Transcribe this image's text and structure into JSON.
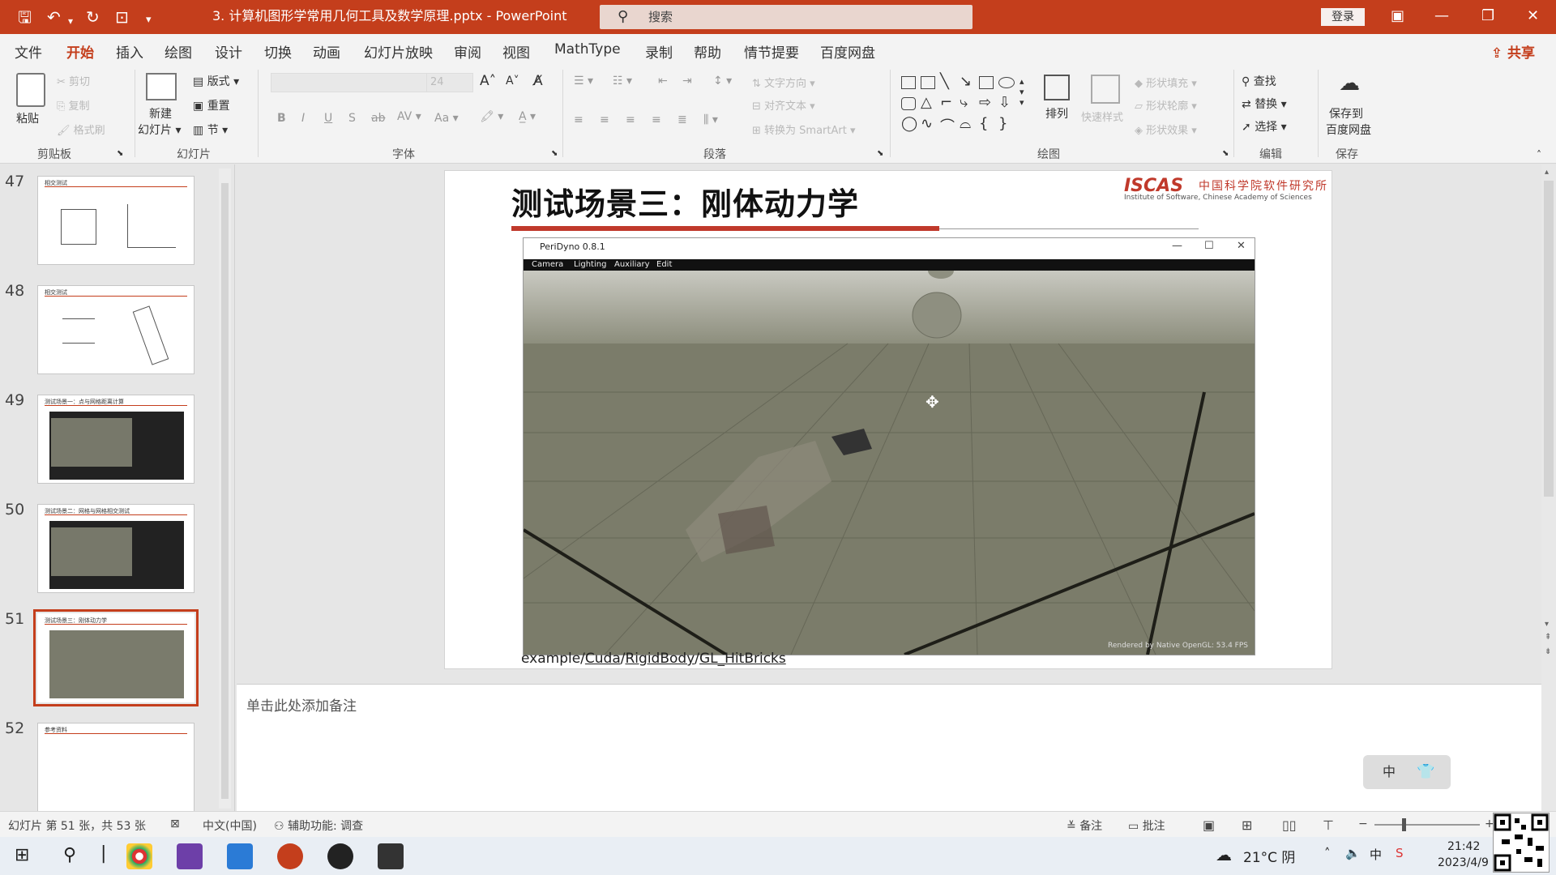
{
  "titlebar": {
    "doc_title": "3. 计算机图形学常用几何工具及数学原理.pptx - PowerPoint",
    "search_placeholder": "搜索",
    "signin_label": "登录"
  },
  "menu_tabs": [
    "文件",
    "开始",
    "插入",
    "绘图",
    "设计",
    "切换",
    "动画",
    "幻灯片放映",
    "审阅",
    "视图",
    "MathType",
    "录制",
    "帮助",
    "情节提要",
    "百度网盘"
  ],
  "share_label": "共享",
  "ribbon": {
    "clipboard": {
      "paste": "粘贴",
      "cut": "剪切",
      "copy": "复制",
      "format_painter": "格式刷",
      "group": "剪贴板"
    },
    "slides": {
      "new_slide": "新建",
      "new_slide2": "幻灯片",
      "layout": "版式",
      "reset": "重置",
      "section": "节",
      "group": "幻灯片"
    },
    "font": {
      "group": "字体",
      "size": "24"
    },
    "paragraph": {
      "text_direction": "文字方向",
      "align_text": "对齐文本",
      "smartart": "转换为 SmartArt",
      "group": "段落"
    },
    "drawing": {
      "arrange": "排列",
      "quick_styles": "快速样式",
      "shape_fill": "形状填充",
      "shape_outline": "形状轮廓",
      "shape_effects": "形状效果",
      "group": "绘图"
    },
    "editing": {
      "find": "查找",
      "replace": "替换",
      "select": "选择",
      "group": "编辑"
    },
    "save": {
      "save_to": "保存到",
      "baidu": "百度网盘",
      "group": "保存"
    }
  },
  "thumbnails": [
    {
      "num": "47",
      "title": "相交测试"
    },
    {
      "num": "48",
      "title": "相交测试"
    },
    {
      "num": "49",
      "title": "测试场景一：点与网格距离计算"
    },
    {
      "num": "50",
      "title": "测试场景二：网格与网格相交测试"
    },
    {
      "num": "51",
      "title": "测试场景三：刚体动力学"
    },
    {
      "num": "52",
      "title": "参考资料"
    }
  ],
  "slide": {
    "title": "测试场景三：刚体动力学",
    "logo_main": "ISCAS",
    "logo_cn": "中国科学院软件研究所",
    "logo_en": "Institute of Software, Chinese Academy of Sciences",
    "app_title": "PeriDyno 0.8.1",
    "app_menu": [
      "Camera",
      "Lighting",
      "Auxiliary",
      "Edit"
    ],
    "fps_text": "Rendered by Native OpenGL: 53.4 FPS",
    "caption_parts": [
      "example/",
      "Cuda",
      "/",
      "RigidBody",
      "/",
      "GL_HitBricks"
    ]
  },
  "notes_placeholder": "单击此处添加备注",
  "status": {
    "slide_info": "幻灯片 第 51 张，共 53 张",
    "language": "中文(中国)",
    "accessibility": "辅助功能: 调查",
    "notes_btn": "备注",
    "comments_btn": "批注",
    "zoom_minus": "−",
    "zoom_plus": "+"
  },
  "ime": {
    "label": "中"
  },
  "taskbar": {
    "weather": "21°C 阴",
    "time": "21:42",
    "date": "2023/4/9"
  }
}
